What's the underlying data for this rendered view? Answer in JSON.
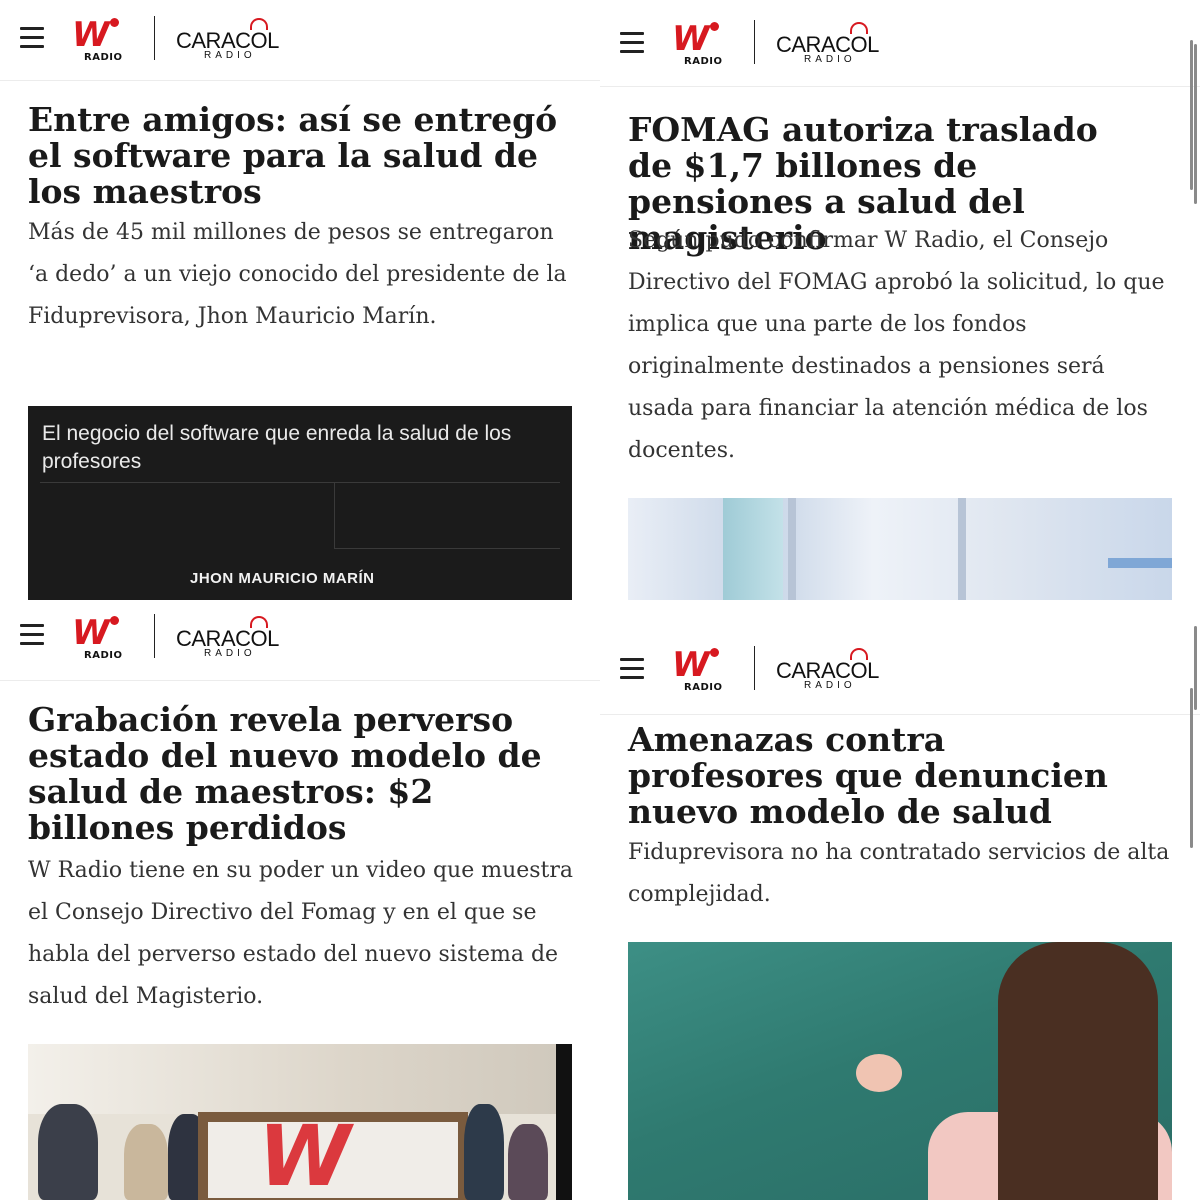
{
  "header": {
    "w_label": "W",
    "w_sub": "RADIO",
    "caracol_name": "CARACOL",
    "caracol_sub": "RADIO"
  },
  "articles": [
    {
      "headline": "Entre amigos: así se entregó el software para la salud de los maestros",
      "summary": "Más de 45 mil millones de pesos se entregaron ‘a dedo’ a un viejo conocido del presidente de la Fiduprevisora, Jhon Mauricio Marín.",
      "media": {
        "title": "El negocio del software que enreda la salud de los profesores",
        "caption": "JHON MAURICIO MARÍN"
      }
    },
    {
      "headline": "FOMAG autoriza traslado de $1,7 billones de pensiones a salud del magisterio",
      "summary": "Según pudo confirmar W Radio, el Consejo Directivo del FOMAG aprobó la solicitud, lo que implica que una parte de los fondos originalmente destinados a pensiones será usada para financiar la atención médica de los docentes."
    },
    {
      "headline": "Grabación revela perverso estado del nuevo modelo de salud de maestros: $2 billones perdidos",
      "summary": "W Radio tiene en su poder un video que muestra el Consejo Directivo del Fomag y en el que se habla del perverso estado del nuevo sistema de salud del Magisterio."
    },
    {
      "headline": "Amenazas contra profesores que denuncien nuevo modelo de salud",
      "summary": "Fiduprevisora no ha contratado servicios de alta complejidad."
    }
  ],
  "colors": {
    "brand_red": "#d71920",
    "text_dark": "#1a1a1a",
    "text_body": "#333333"
  }
}
